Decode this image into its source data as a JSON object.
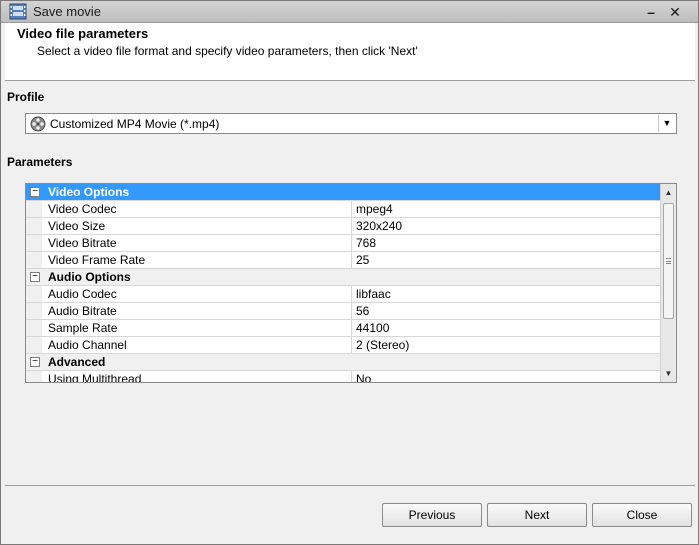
{
  "window": {
    "title": "Save movie"
  },
  "header": {
    "title": "Video file parameters",
    "subtitle": "Select a video file format and specify video parameters, then click 'Next'"
  },
  "profile": {
    "label": "Profile",
    "selected": "Customized MP4 Movie (*.mp4)"
  },
  "parameters": {
    "label": "Parameters",
    "video_header": "Video Options",
    "video": [
      {
        "name": "Video Codec",
        "value": "mpeg4"
      },
      {
        "name": "Video Size",
        "value": "320x240"
      },
      {
        "name": "Video Bitrate",
        "value": "768"
      },
      {
        "name": "Video Frame Rate",
        "value": "25"
      }
    ],
    "audio_header": "Audio Options",
    "audio": [
      {
        "name": "Audio Codec",
        "value": "libfaac"
      },
      {
        "name": "Audio Bitrate",
        "value": "56"
      },
      {
        "name": "Sample Rate",
        "value": "44100"
      },
      {
        "name": "Audio Channel",
        "value": "2 (Stereo)"
      }
    ],
    "advanced_header": "Advanced",
    "advanced": [
      {
        "name": "Using Multithread",
        "value": "No"
      }
    ]
  },
  "buttons": {
    "previous": "Previous",
    "next": "Next",
    "close": "Close"
  },
  "colors": {
    "selected_row": "#3399ff",
    "window_bg": "#f0f0f0"
  }
}
